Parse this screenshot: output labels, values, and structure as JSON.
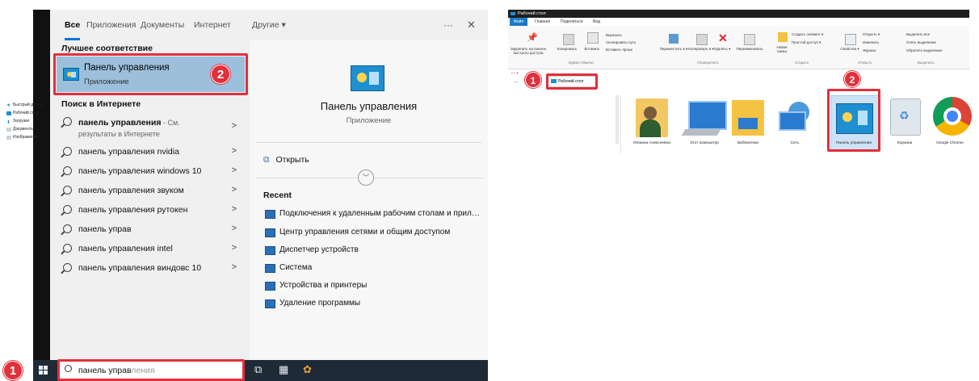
{
  "start_menu": {
    "tabs": [
      {
        "label": "Все"
      },
      {
        "label": "Приложения"
      },
      {
        "label": "Документы"
      },
      {
        "label": "Интернет"
      },
      {
        "label": "Другие ▾"
      }
    ],
    "more_icon": "ellipsis-icon",
    "more_label": "···",
    "close_label": "✕",
    "best_match_header": "Лучшее соответствие",
    "best_match": {
      "title": "Панель управления",
      "subtitle": "Приложение"
    },
    "web_header": "Поиск в Интернете",
    "web_results": [
      {
        "text": "панель управления",
        "suffix": " - См. результаты в Интернете"
      },
      {
        "text": "панель управления nvidia"
      },
      {
        "text": "панель управления windows 10"
      },
      {
        "text": "панель управления звуком"
      },
      {
        "text": "панель управления рутокен"
      },
      {
        "text": "панель управ"
      },
      {
        "text": "панель управления intel"
      },
      {
        "text": "панель управления виндовс 10"
      }
    ],
    "details": {
      "title": "Панель управления",
      "subtitle": "Приложение",
      "open_label": "Открыть",
      "recent_header": "Recent",
      "recent": [
        "Подключения к удаленным рабочим столам и прилож...",
        "Центр управления сетями и общим доступом",
        "Диспетчер устройств",
        "Система",
        "Устройства и принтеры",
        "Удаление программы"
      ]
    }
  },
  "taskbar": {
    "search_typed": "панель управ",
    "search_ghost": "ления"
  },
  "annotations": {
    "badge_taskbar": "1",
    "badge_best": "2",
    "badge_address": "1",
    "badge_icon": "2",
    "color": "#e0303c"
  },
  "explorer": {
    "window_title": "Рабочий стол",
    "menu": [
      "Файл",
      "Главная",
      "Поделиться",
      "Вид"
    ],
    "ribbon": {
      "pin": "Закрепить на панели быстрого доступа",
      "copy": "Копировать",
      "paste": "Вставить",
      "cut": "Вырезать",
      "copy_path": "Скопировать путь",
      "paste_shortcut": "Вставить ярлык",
      "move_to": "Переместить в ▾",
      "copy_to": "Копировать в ▾",
      "delete": "Удалить ▾",
      "rename": "Переименовать",
      "new_folder": "Новая папка",
      "new_item": "Создать элемент ▾",
      "easy_access": "Простой доступ ▾",
      "properties": "Свойства ▾",
      "open": "Открыть ▾",
      "edit": "Изменить",
      "history": "Журнал",
      "select_all": "Выделить все",
      "select_none": "Снять выделение",
      "invert": "Обратить выделение",
      "groups": [
        "Буфер обмена",
        "Упорядочить",
        "Создать",
        "Открыть",
        "Выделить"
      ]
    },
    "address": "Рабочий стол",
    "nav": [
      "Быстрый доступ",
      "Рабочий стол",
      "Загрузки",
      "Документы",
      "Изображения"
    ],
    "items": [
      "Юлиана Алексеевна",
      "Этот компьютер",
      "Библиотеки",
      "Сеть",
      "Панель управления",
      "Корзина",
      "Google Chrome"
    ]
  }
}
